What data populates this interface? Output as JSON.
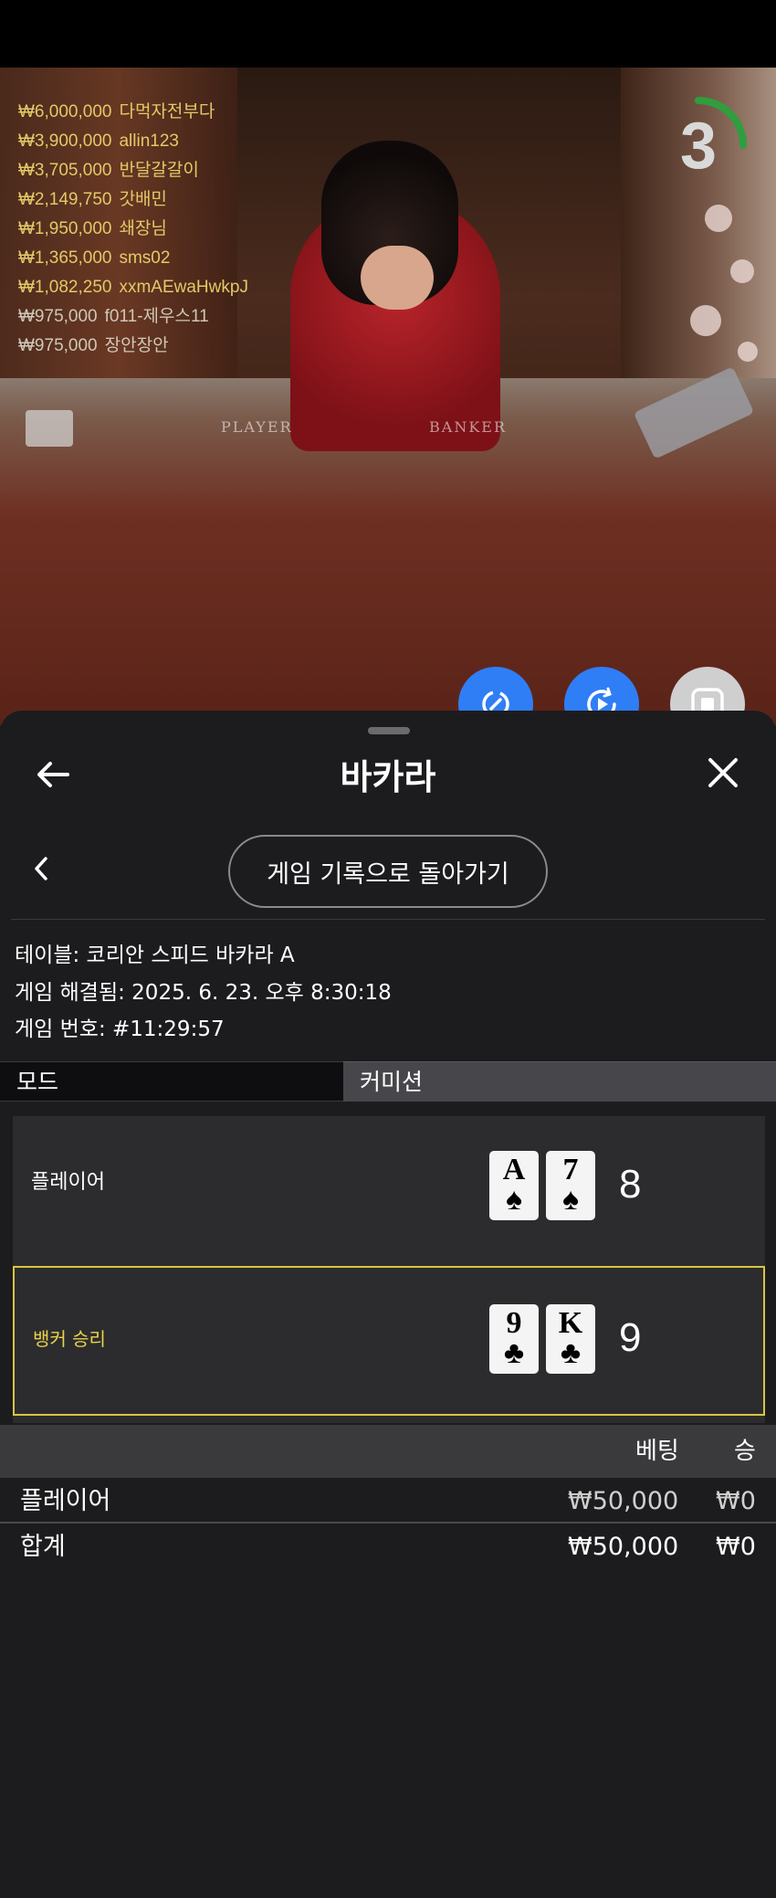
{
  "leaderboard": {
    "rows": [
      {
        "amount": "₩6,000,000",
        "name": "다먹자전부다"
      },
      {
        "amount": "₩3,900,000",
        "name": "allin123"
      },
      {
        "amount": "₩3,705,000",
        "name": "반달갈갈이"
      },
      {
        "amount": "₩2,149,750",
        "name": "갓배민"
      },
      {
        "amount": "₩1,950,000",
        "name": "쇄장님"
      },
      {
        "amount": "₩1,365,000",
        "name": "sms02"
      },
      {
        "amount": "₩1,082,250",
        "name": "xxmAEwaHwkpJ"
      },
      {
        "amount": "₩975,000",
        "name": "f011-제우스11"
      },
      {
        "amount": "₩975,000",
        "name": "장안장안"
      }
    ]
  },
  "video": {
    "player_felt": "PLAYER",
    "banker_felt": "BANKER",
    "timer": "3"
  },
  "header": {
    "title": "바카라"
  },
  "history": {
    "back_button": "게임 기록으로 돌아가기"
  },
  "game_info": {
    "table": "테이블: 코리안 스피드 바카라 A",
    "resolved": "게임 해결됨: 2025. 6. 23. 오후 8:30:18",
    "game_number": "게임 번호: #11:29:57"
  },
  "tabs": {
    "mode": "모드",
    "commission": "커미션"
  },
  "hands": {
    "player": {
      "label": "플레이어",
      "cards": [
        {
          "rank": "A",
          "suit": "♠"
        },
        {
          "rank": "7",
          "suit": "♠"
        }
      ],
      "score": "8"
    },
    "banker": {
      "label": "뱅커 승리",
      "cards": [
        {
          "rank": "9",
          "suit": "♣"
        },
        {
          "rank": "K",
          "suit": "♣"
        }
      ],
      "score": "9"
    }
  },
  "bets": {
    "col_bet": "베팅",
    "col_win": "승",
    "rows": [
      {
        "name": "플레이어",
        "bet": "₩50,000",
        "win": "₩0"
      }
    ],
    "total": {
      "name": "합계",
      "bet": "₩50,000",
      "win": "₩0"
    }
  },
  "colors": {
    "accent_blue": "#2f7ef5",
    "winner_yellow": "#d8c540",
    "leaderboard_gold": "#e3c967"
  },
  "icons": {
    "back": "arrow-left-icon",
    "close": "close-icon",
    "history_back": "chevron-left-icon",
    "fab1": "rotate-sync-icon",
    "fab2": "replay-icon",
    "fab3": "stop-icon"
  }
}
